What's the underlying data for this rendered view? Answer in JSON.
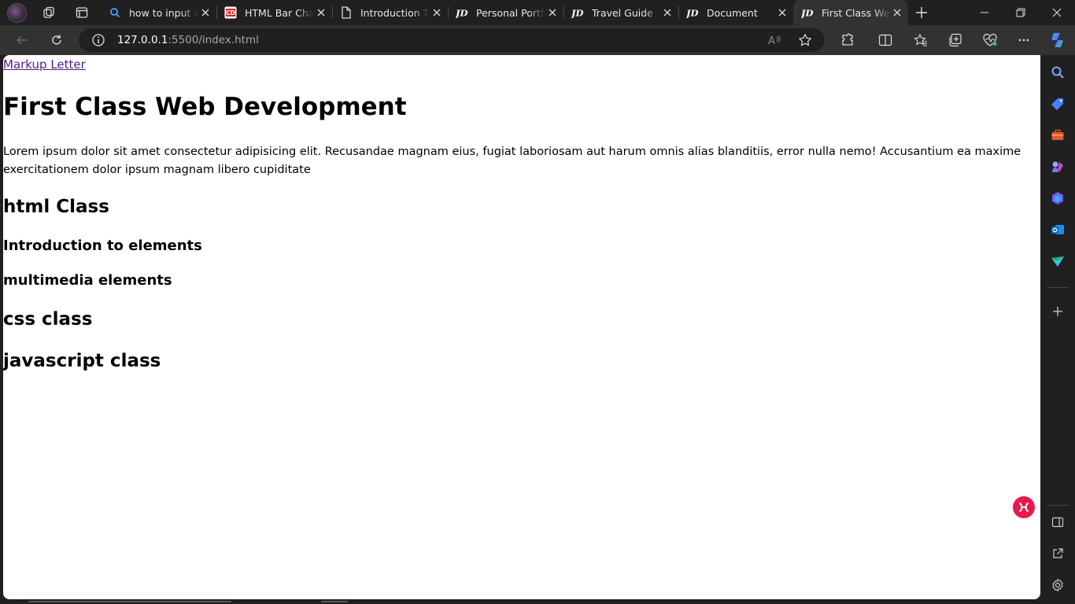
{
  "browser": {
    "tabs": [
      {
        "label": "how to input a",
        "favicon": "search-icon"
      },
      {
        "label": "HTML Bar Char",
        "favicon": "cd-logo-icon"
      },
      {
        "label": "Introduction To",
        "favicon": "document-icon"
      },
      {
        "label": "Personal Portfo",
        "favicon": "jd-logo-icon"
      },
      {
        "label": "Travel Guide",
        "favicon": "jd-logo-icon"
      },
      {
        "label": "Document",
        "favicon": "jd-logo-icon"
      },
      {
        "label": "First Class Web",
        "favicon": "jd-logo-icon",
        "active": true
      }
    ],
    "address": {
      "host": "127.0.0.1",
      "path": ":5500/index.html"
    },
    "colors": {
      "frame": "#202020",
      "toolbar": "#323232",
      "accent_badge": "#e8194c"
    }
  },
  "page": {
    "link": "Markup Letter",
    "h1": "First Class Web Development",
    "paragraph": "Lorem ipsum dolor sit amet consectetur adipisicing elit. Recusandae magnam eius, fugiat laboriosam aut harum omnis alias blanditiis, error nulla nemo! Accusantium ea maxime exercitationem dolor ipsum magnam libero cupiditate",
    "h2_html": "html Class",
    "h3_intro": "Introduction to elements",
    "h3_multimedia": "multimedia elements",
    "h2_css": "css class",
    "h2_js": "javascript class"
  }
}
